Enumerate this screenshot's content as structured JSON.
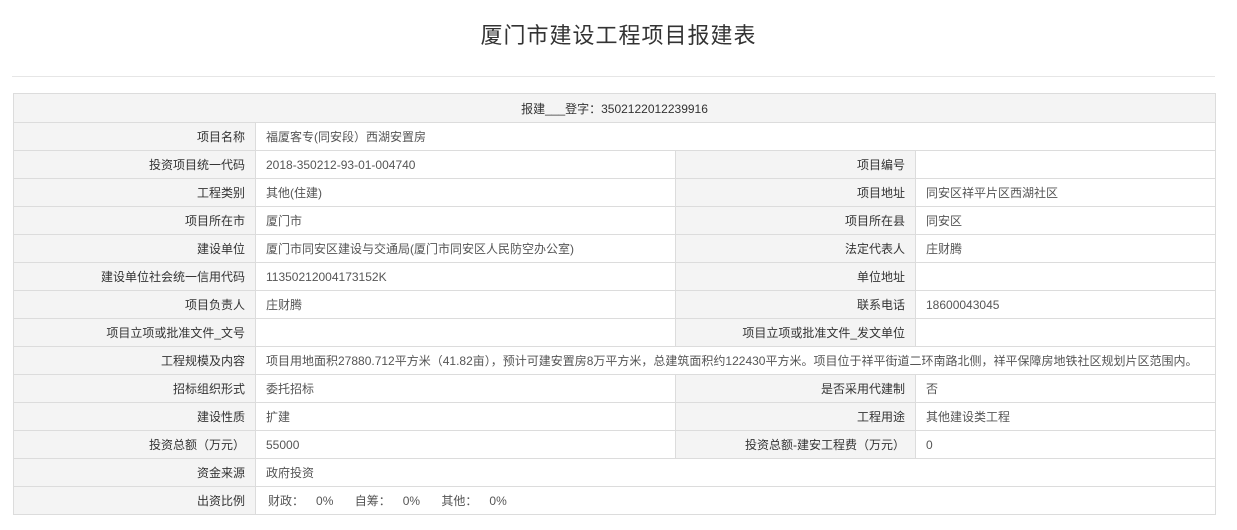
{
  "page": {
    "title": "厦门市建设工程项目报建表"
  },
  "report": {
    "header": "报建___登字：3502122012239916",
    "rows": {
      "project_name": {
        "label": "项目名称",
        "value": "福厦客专(同安段）西湖安置房"
      },
      "invest_code": {
        "label": "投资项目统一代码",
        "value": "2018-350212-93-01-004740"
      },
      "project_no": {
        "label": "项目编号",
        "value": ""
      },
      "eng_category": {
        "label": "工程类别",
        "value": "其他(住建)"
      },
      "project_address": {
        "label": "项目地址",
        "value": "同安区祥平片区西湖社区"
      },
      "city": {
        "label": "项目所在市",
        "value": "厦门市"
      },
      "county": {
        "label": "项目所在县",
        "value": "同安区"
      },
      "builder": {
        "label": "建设单位",
        "value": "厦门市同安区建设与交通局(厦门市同安区人民防空办公室)"
      },
      "legal_rep": {
        "label": "法定代表人",
        "value": "庄财腾"
      },
      "credit_code": {
        "label": "建设单位社会统一信用代码",
        "value": "11350212004173152K"
      },
      "unit_address": {
        "label": "单位地址",
        "value": ""
      },
      "manager": {
        "label": "项目负责人",
        "value": "庄财腾"
      },
      "phone": {
        "label": "联系电话",
        "value": "18600043045"
      },
      "approval_doc_no": {
        "label": "项目立项或批准文件_文号",
        "value": ""
      },
      "approval_issuer": {
        "label": "项目立项或批准文件_发文单位",
        "value": ""
      },
      "scale": {
        "label": "工程规模及内容",
        "value": "项目用地面积27880.712平方米（41.82亩），预计可建安置房8万平方米，总建筑面积约122430平方米。项目位于祥平街道二环南路北侧，祥平保障房地铁社区规划片区范围内。"
      },
      "bidding_form": {
        "label": "招标组织形式",
        "value": "委托招标"
      },
      "agent_system": {
        "label": "是否采用代建制",
        "value": "否"
      },
      "nature": {
        "label": "建设性质",
        "value": "扩建"
      },
      "usage": {
        "label": "工程用途",
        "value": "其他建设类工程"
      },
      "total_invest": {
        "label": "投资总额（万元）",
        "value": "55000"
      },
      "construction_cost": {
        "label": "投资总额-建安工程费（万元）",
        "value": "0"
      },
      "fund_source": {
        "label": "资金来源",
        "value": "政府投资"
      },
      "ratio": {
        "label": "出资比例",
        "finance_label": "财政：",
        "finance_value": "0%",
        "self_label": "自筹：",
        "self_value": "0%",
        "other_label": "其他：",
        "other_value": "0%"
      }
    }
  }
}
